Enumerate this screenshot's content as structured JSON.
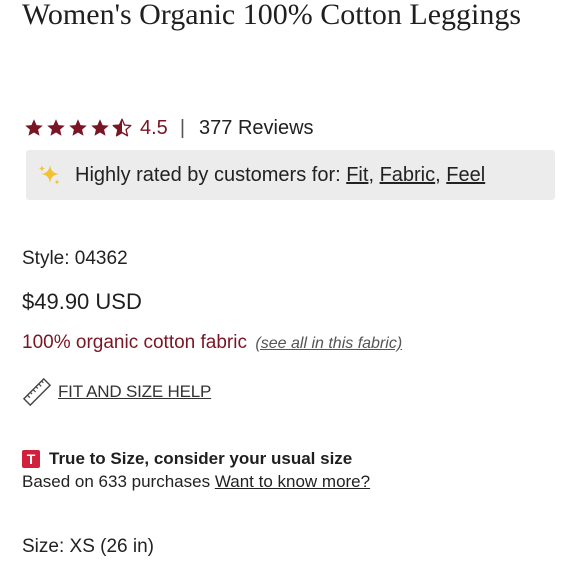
{
  "product": {
    "title": "Women's Organic 100% Cotton Leggings",
    "rating_value": "4.5",
    "rating_stars": 4.5,
    "separator": "|",
    "reviews_label": "377 Reviews"
  },
  "highlight": {
    "icon": "sparkle-icon",
    "prefix": "Highly rated by customers for:",
    "tags": [
      "Fit",
      "Fabric",
      "Feel"
    ],
    "sep": ","
  },
  "details": {
    "style_label": "Style: 04362",
    "price": "$49.90 USD",
    "fabric": "100% organic cotton fabric",
    "fabric_link": "(see all in this fabric)",
    "fit_help": "FIT AND SIZE HELP",
    "fit_icon": "ruler-icon"
  },
  "size_info": {
    "badge": "T",
    "true_to_size": "True to Size, consider your usual size",
    "based_on": "Based on 633 purchases",
    "more_link": "Want to know more?",
    "size_label": "Size: XS (26 in)"
  },
  "colors": {
    "accent": "#7a1624",
    "badge": "#d0203c",
    "highlight_bg": "#ececec"
  }
}
